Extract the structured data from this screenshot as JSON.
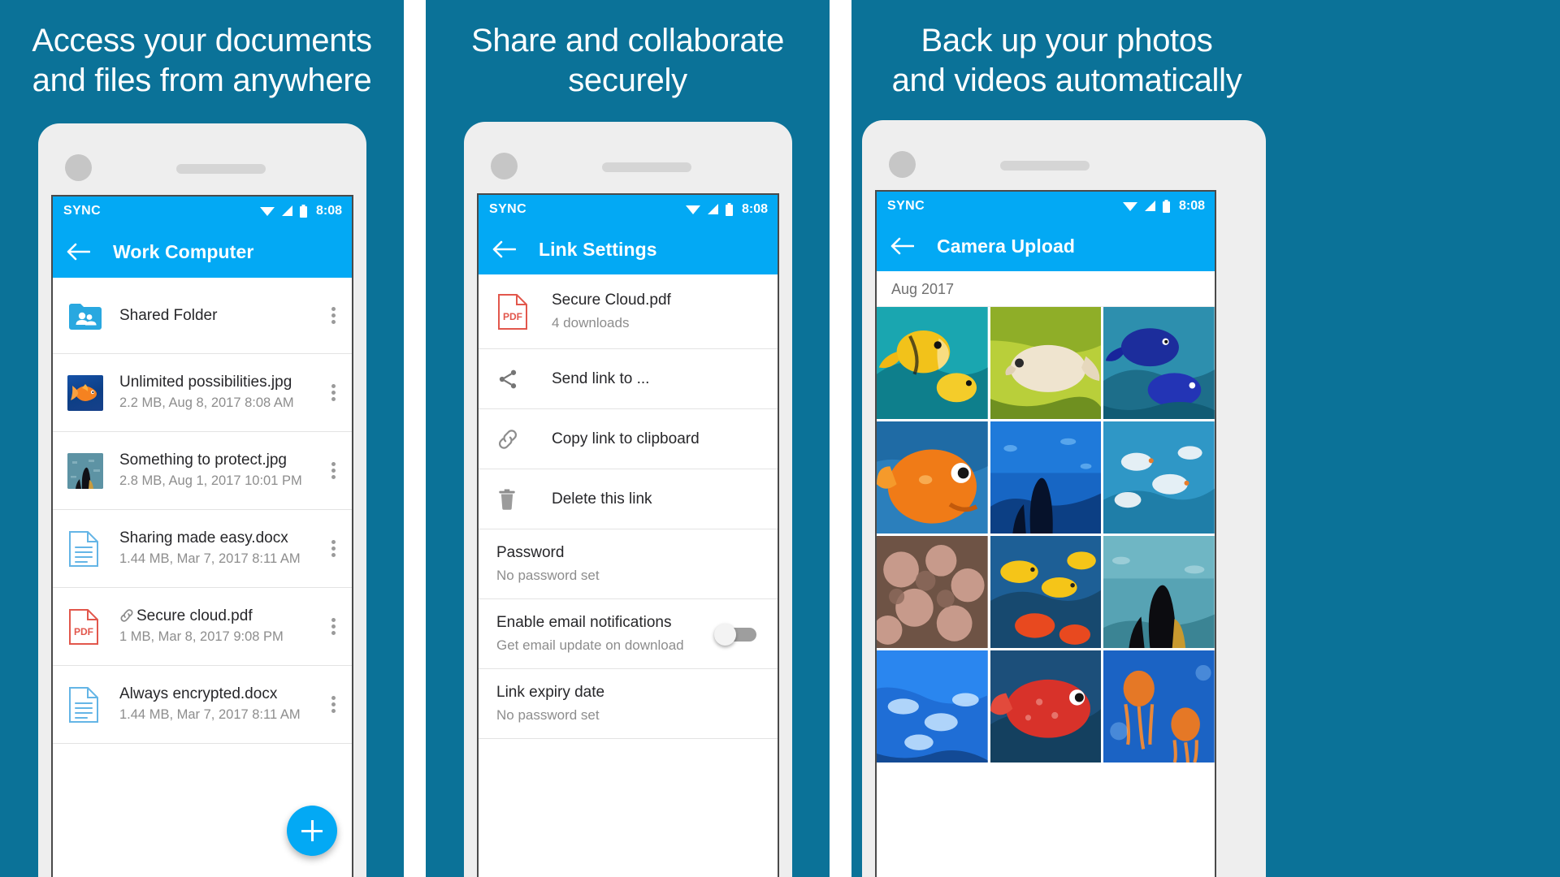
{
  "panels": [
    {
      "headline": [
        "Access your documents",
        "and files from anywhere"
      ],
      "statusbar": {
        "label": "SYNC",
        "time": "8:08"
      },
      "appbar": {
        "title": "Work Computer",
        "back_icon": "arrow-back-icon"
      },
      "rows": [
        {
          "icon": "shared-folder-icon",
          "title": "Shared Folder",
          "subtitle": "",
          "menu": "overflow-menu-icon"
        },
        {
          "icon": "image-thumbnail-goldfish",
          "title": "Unlimited possibilities.jpg",
          "subtitle": "2.2 MB, Aug 8, 2017 8:08 AM",
          "menu": "overflow-menu-icon"
        },
        {
          "icon": "image-thumbnail-aquarium",
          "title": "Something to protect.jpg",
          "subtitle": "2.8 MB, Aug 1, 2017 10:01 PM",
          "menu": "overflow-menu-icon"
        },
        {
          "icon": "docx-file-icon",
          "title": "Sharing made easy.docx",
          "subtitle": "1.44 MB, Mar 7, 2017 8:11 AM",
          "menu": "overflow-menu-icon"
        },
        {
          "icon": "pdf-file-icon",
          "title": "Secure cloud.pdf",
          "subtitle": "1 MB, Mar 8, 2017 9:08 PM",
          "menu": "overflow-menu-icon",
          "prefix_icon": "link-chain-icon"
        },
        {
          "icon": "docx-file-icon",
          "title": "Always encrypted.docx",
          "subtitle": "1.44 MB, Mar 7, 2017 8:11 AM",
          "menu": "overflow-menu-icon"
        }
      ],
      "fab": {
        "icon": "add-plus-icon"
      }
    },
    {
      "headline": [
        "Share and collaborate",
        "securely"
      ],
      "statusbar": {
        "label": "SYNC",
        "time": "8:08"
      },
      "appbar": {
        "title": "Link Settings",
        "back_icon": "arrow-back-icon"
      },
      "file": {
        "icon": "pdf-file-icon",
        "title": "Secure Cloud.pdf",
        "subtitle": "4 downloads"
      },
      "actions": [
        {
          "icon": "share-icon",
          "label": "Send link to ..."
        },
        {
          "icon": "link-chain-icon",
          "label": "Copy link to clipboard"
        },
        {
          "icon": "trash-icon",
          "label": "Delete this link"
        }
      ],
      "settings": [
        {
          "title": "Password",
          "subtitle": "No password set",
          "control": "none"
        },
        {
          "title": "Enable email notifications",
          "subtitle": "Get email update on download",
          "control": "toggle",
          "toggle_on": false
        },
        {
          "title": "Link expiry date",
          "subtitle": "No password set",
          "control": "none"
        }
      ]
    },
    {
      "headline": [
        "Back up your photos",
        "and videos automatically"
      ],
      "statusbar": {
        "label": "SYNC",
        "time": "8:08"
      },
      "appbar": {
        "title": "Camera Upload",
        "back_icon": "arrow-back-icon"
      },
      "month_header": "Aug 2017",
      "photos": [
        "butterflyfish-yellow",
        "goldfish-pale-green",
        "blue-discus-fish",
        "goldfish-orange-closeup",
        "aquarium-silhouette-blue",
        "small-fish-school",
        "coral-reef-pink",
        "yellow-fish-coral",
        "girl-aquarium-silhouette",
        "blue-fish-school",
        "red-grouper-fish",
        "jellyfish-orange"
      ]
    }
  ],
  "colors": {
    "brand_blue": "#0b7298",
    "appbar_blue": "#03a9f4",
    "accent": "#03a9f4",
    "pdf_red": "#e2574c",
    "docx_blue": "#64b5e6"
  }
}
